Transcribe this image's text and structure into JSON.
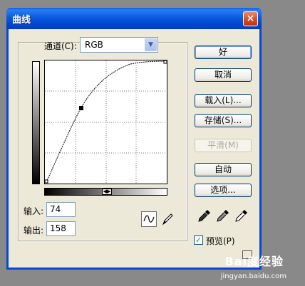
{
  "window": {
    "title": "曲线",
    "close_icon": "×"
  },
  "channel": {
    "label": "通道(C):",
    "value": "RGB"
  },
  "input": {
    "label": "输入:",
    "value": "74"
  },
  "output": {
    "label": "输出:",
    "value": "158"
  },
  "buttons": {
    "ok": "好",
    "cancel": "取消",
    "load": "载入(L)...",
    "save": "存储(S)...",
    "smooth": "平滑(M)",
    "auto": "自动",
    "options": "选项..."
  },
  "preview": {
    "label": "预览(P)",
    "checked": true
  },
  "curve": {
    "selected_point": {
      "input": 74,
      "output": 158
    }
  },
  "watermark": {
    "brand": "Bai度经验",
    "url": "jingyan.baidu.com"
  }
}
